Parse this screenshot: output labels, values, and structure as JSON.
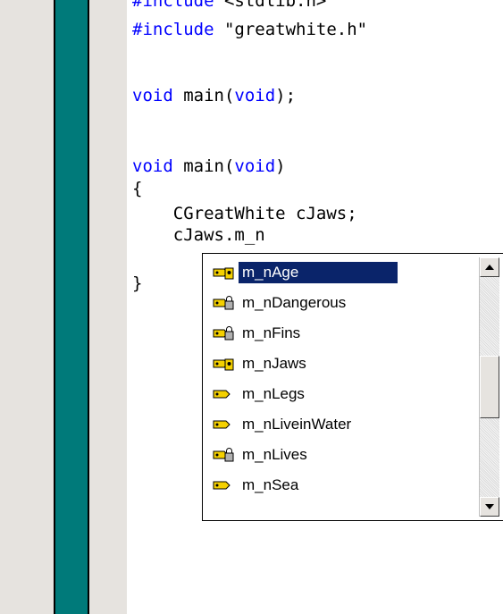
{
  "editor": {
    "lines": [
      {
        "kw": "#include",
        "rest": " <stdlib.h>"
      },
      {
        "kw": "#include",
        "rest": " \"greatwhite.h\""
      },
      {
        "kw": "void",
        "rest": " main(",
        "kw2": "void",
        "rest2": ");"
      },
      {
        "kw": "void",
        "rest": " main(",
        "kw2": "void",
        "rest2": ")"
      },
      {
        "text": "{"
      },
      {
        "text": "    CGreatWhite cJaws;"
      },
      {
        "text": "    cJaws.m_n"
      },
      {
        "text": "}"
      }
    ]
  },
  "autocomplete": {
    "items": [
      {
        "label": "m_nAge",
        "icon": "protected-member-icon",
        "selected": true
      },
      {
        "label": "m_nDangerous",
        "icon": "private-member-icon"
      },
      {
        "label": "m_nFins",
        "icon": "private-member-icon"
      },
      {
        "label": "m_nJaws",
        "icon": "protected-member-icon"
      },
      {
        "label": "m_nLegs",
        "icon": "public-member-icon"
      },
      {
        "label": "m_nLiveinWater",
        "icon": "public-member-icon"
      },
      {
        "label": "m_nLives",
        "icon": "private-member-icon"
      },
      {
        "label": "m_nSea",
        "icon": "public-member-icon"
      }
    ]
  },
  "colors": {
    "keyword": "#0000ff",
    "gutter": "#007a7a",
    "selection": "#0a246a"
  }
}
